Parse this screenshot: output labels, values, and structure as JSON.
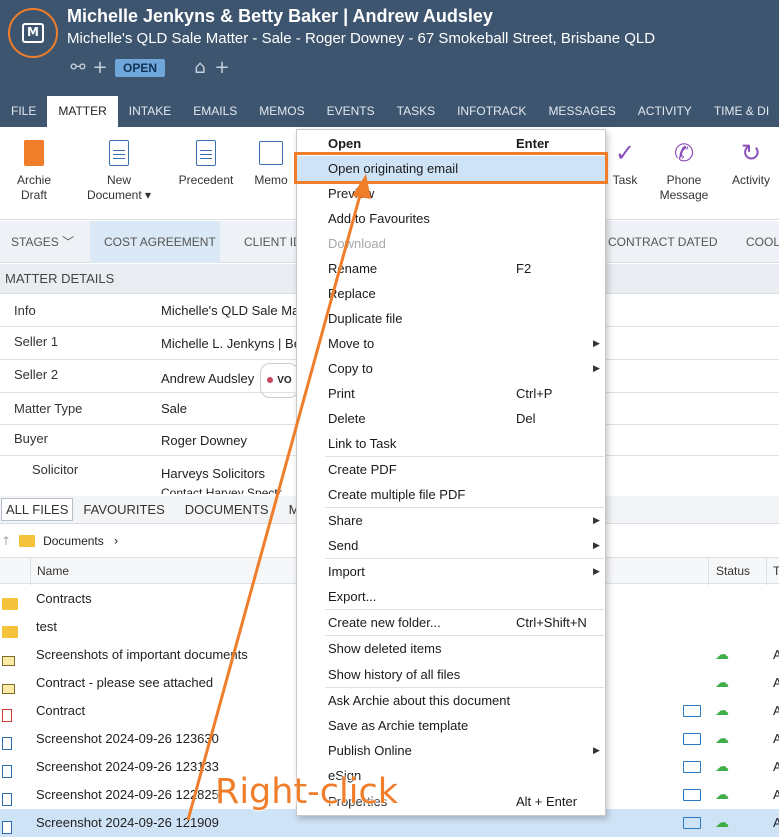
{
  "header": {
    "title": "Michelle Jenkyns & Betty Baker | Andrew Audsley",
    "subtitle": "Michelle's QLD Sale Matter - Sale - Roger Downey - 67 Smokeball Street, Brisbane QLD",
    "status_badge": "OPEN",
    "icons": [
      "share-add-icon",
      "tag-add-icon"
    ]
  },
  "tabs": [
    "FILE",
    "MATTER",
    "INTAKE",
    "EMAILS",
    "MEMOS",
    "EVENTS",
    "TASKS",
    "INFOTRACK",
    "MESSAGES",
    "ACTIVITY",
    "TIME & DI"
  ],
  "active_tab": "MATTER",
  "ribbon": {
    "archie": "Archie Draft",
    "archie_l1": "Archie",
    "archie_l2": "Draft",
    "new_doc_l1": "New",
    "new_doc_l2": "Document ▾",
    "precedent": "Precedent",
    "memo": "Memo",
    "task": "Task",
    "phone_l1": "Phone",
    "phone_l2": "Message",
    "activity": "Activity"
  },
  "stages": {
    "label": "STAGES",
    "items": [
      "COST AGREEMENT",
      "CLIENT ID",
      "CONTRACT DATED",
      "COOLI"
    ]
  },
  "matter_details": {
    "heading": "MATTER DETAILS",
    "rows": [
      {
        "label": "Info",
        "value": "Michelle's QLD Sale Ma"
      },
      {
        "label": "Seller 1",
        "value": "Michelle L. Jenkyns | Be"
      },
      {
        "label": "Seller 2",
        "value": "Andrew Audsley",
        "pill": "VO"
      },
      {
        "label": "Matter Type",
        "value": "Sale"
      },
      {
        "label": "Buyer",
        "value": "Roger Downey"
      },
      {
        "label": "Solicitor",
        "value": "Harveys Solicitors",
        "value2": "Contact Harvey Spectr"
      }
    ]
  },
  "files": {
    "tabs": [
      "ALL FILES",
      "FAVOURITES",
      "DOCUMENTS",
      "M"
    ],
    "breadcrumb": "Documents",
    "columns": {
      "name": "Name",
      "status": "Status",
      "extra": "T"
    },
    "rows": [
      {
        "name": "Contracts",
        "type": "folder-star"
      },
      {
        "name": "test",
        "type": "folder"
      },
      {
        "name": "Screenshots of important documents",
        "type": "message",
        "sync": true
      },
      {
        "name": "Contract - please see attached",
        "type": "message",
        "sync": true
      },
      {
        "name": "Contract",
        "type": "pdf",
        "mail": true,
        "sync": true
      },
      {
        "name": "Screenshot 2024-09-26 123630",
        "type": "doc",
        "mail": true,
        "sync": true
      },
      {
        "name": "Screenshot 2024-09-26 123133",
        "type": "doc",
        "mail": true,
        "sync": true
      },
      {
        "name": "Screenshot 2024-09-26 122825",
        "type": "doc",
        "mail": true,
        "sync": true
      },
      {
        "name": "Screenshot 2024-09-26 121909",
        "type": "doc",
        "mail": true,
        "sync": true,
        "selected": true
      }
    ],
    "row_suffix": "A"
  },
  "context_menu": {
    "items": [
      {
        "label": "Open",
        "shortcut": "Enter",
        "bold": true
      },
      {
        "label": "Open originating email",
        "highlighted": true
      },
      {
        "label": "Preview"
      },
      {
        "label": "Add to Favourites"
      },
      {
        "label": "Download",
        "disabled": true
      },
      {
        "label": "Rename",
        "shortcut": "F2"
      },
      {
        "label": "Replace"
      },
      {
        "label": "Duplicate file"
      },
      {
        "label": "Move to",
        "submenu": true
      },
      {
        "label": "Copy to",
        "submenu": true
      },
      {
        "label": "Print",
        "shortcut": "Ctrl+P"
      },
      {
        "label": "Delete",
        "shortcut": "Del"
      },
      {
        "label": "Link to Task"
      },
      {
        "label": "Create PDF"
      },
      {
        "label": "Create multiple file PDF"
      },
      {
        "label": "Share",
        "submenu": true
      },
      {
        "label": "Send",
        "submenu": true
      },
      {
        "label": "Import",
        "submenu": true
      },
      {
        "label": "Export..."
      },
      {
        "label": "Create new folder...",
        "shortcut": "Ctrl+Shift+N"
      },
      {
        "label": "Show deleted items"
      },
      {
        "label": "Show history of all files"
      },
      {
        "label": "Ask Archie about this document"
      },
      {
        "label": "Save as Archie template"
      },
      {
        "label": "Publish Online",
        "submenu": true
      },
      {
        "label": "eSign"
      },
      {
        "label": "Properties",
        "shortcut": "Alt + Enter"
      }
    ]
  },
  "annotation": {
    "text": "Right-click",
    "color": "#f07d2a"
  },
  "colors": {
    "header_bg": "#3e556f",
    "accent": "#f07d2a",
    "selection": "#cfe3f7"
  }
}
